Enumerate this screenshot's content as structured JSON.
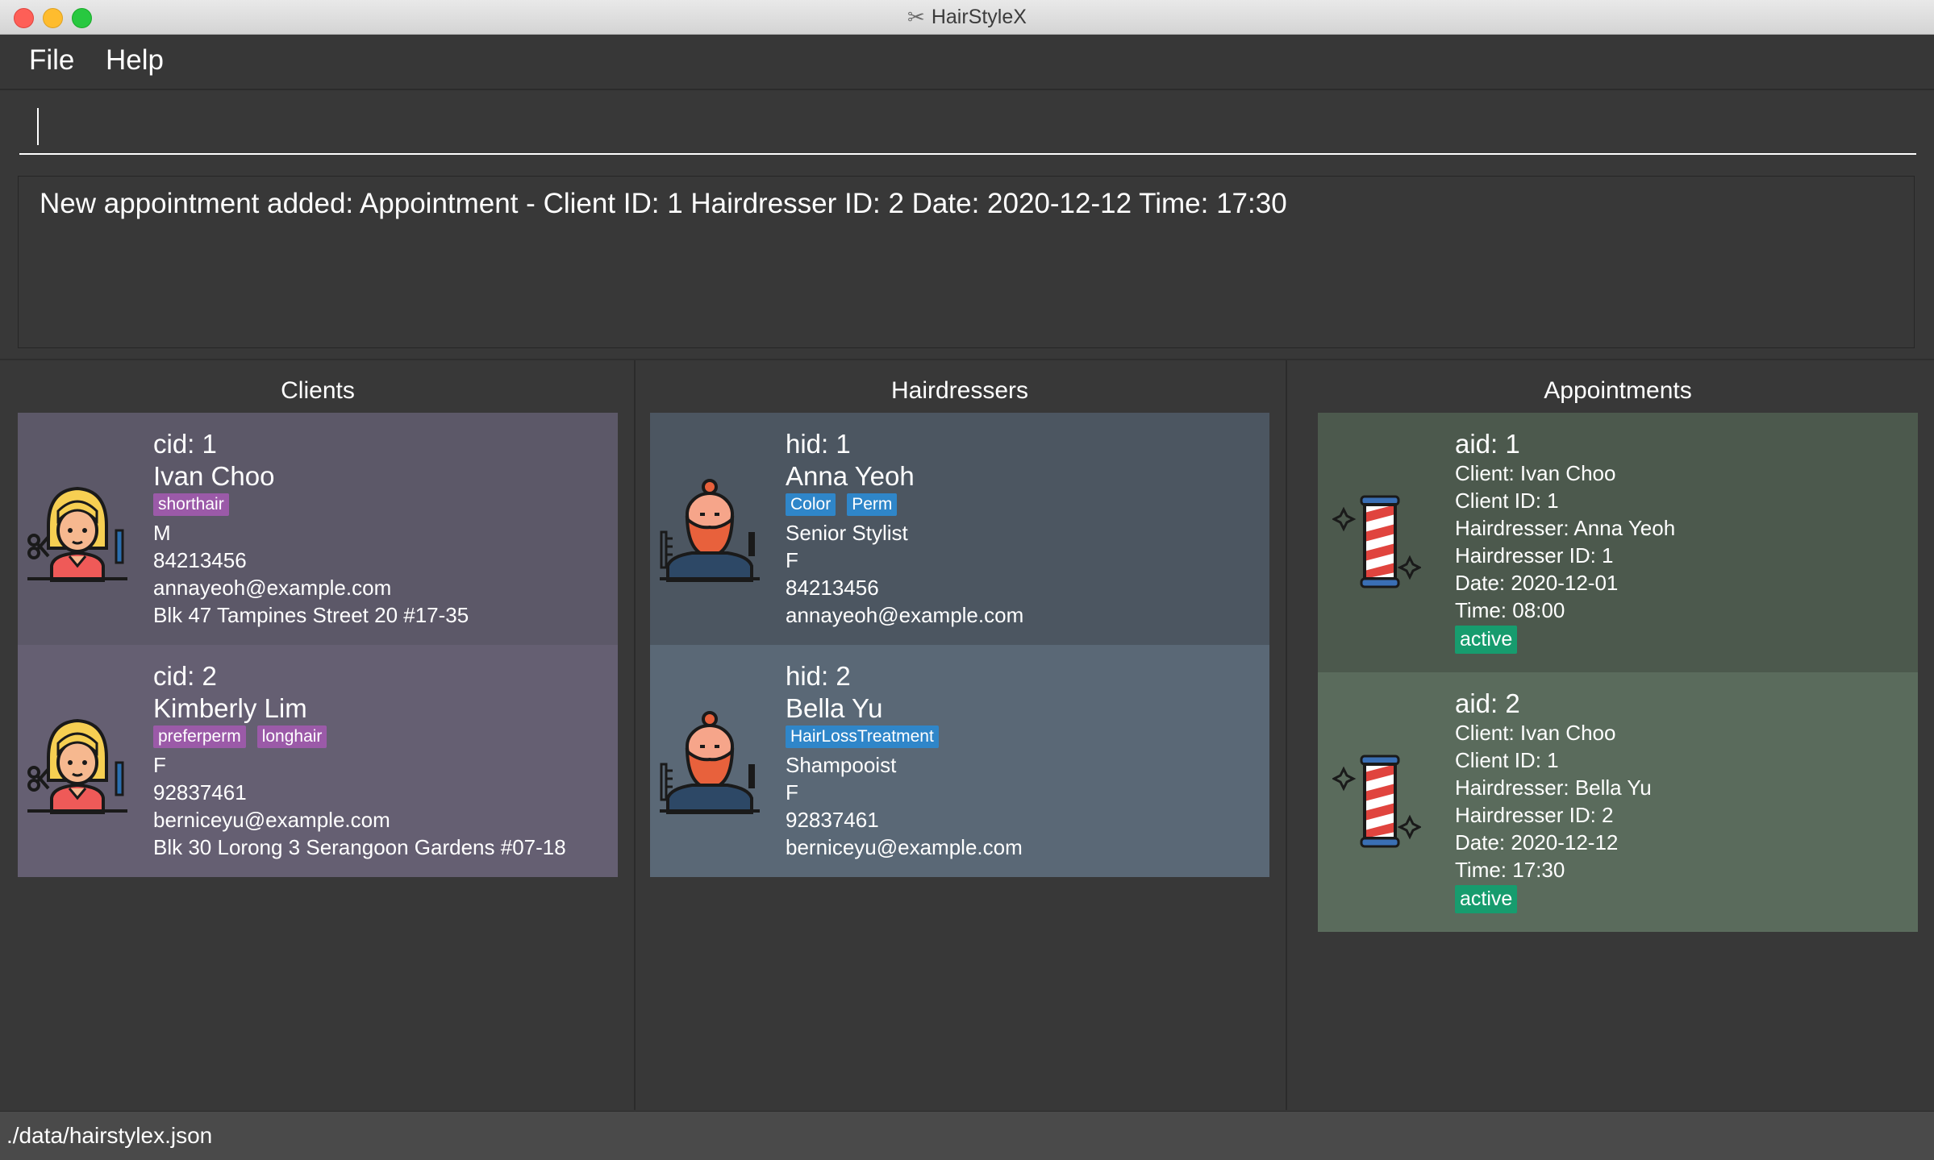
{
  "window": {
    "title": "HairStyleX"
  },
  "menu": {
    "file": "File",
    "help": "Help"
  },
  "command": {
    "value": ""
  },
  "result": {
    "text": "New appointment added: Appointment - Client ID: 1 Hairdresser ID: 2 Date: 2020-12-12 Time: 17:30"
  },
  "columns": {
    "clients": "Clients",
    "hairdressers": "Hairdressers",
    "appointments": "Appointments"
  },
  "clients": [
    {
      "cid": "cid: 1",
      "name": "Ivan Choo",
      "tags": [
        "shorthair"
      ],
      "gender": "M",
      "phone": "84213456",
      "email": "annayeoh@example.com",
      "address": "Blk 47 Tampines Street 20 #17-35"
    },
    {
      "cid": "cid: 2",
      "name": "Kimberly Lim",
      "tags": [
        "preferperm",
        "longhair"
      ],
      "gender": "F",
      "phone": "92837461",
      "email": "berniceyu@example.com",
      "address": "Blk 30 Lorong 3 Serangoon Gardens #07-18"
    }
  ],
  "hairdressers": [
    {
      "hid": "hid: 1",
      "name": "Anna Yeoh",
      "tags": [
        "Color",
        "Perm"
      ],
      "title": "Senior Stylist",
      "gender": "F",
      "phone": "84213456",
      "email": "annayeoh@example.com"
    },
    {
      "hid": "hid: 2",
      "name": "Bella Yu",
      "tags": [
        "HairLossTreatment"
      ],
      "title": "Shampooist",
      "gender": "F",
      "phone": "92837461",
      "email": "berniceyu@example.com"
    }
  ],
  "appointments": [
    {
      "aid": "aid: 1",
      "client": "Client:  Ivan Choo",
      "client_id": "Client ID: 1",
      "hairdresser": "Hairdresser:  Anna Yeoh",
      "hairdresser_id": "Hairdresser ID: 1",
      "date": "Date: 2020-12-01",
      "time": "Time: 08:00",
      "status": "active"
    },
    {
      "aid": "aid: 2",
      "client": "Client:  Ivan Choo",
      "client_id": "Client ID: 1",
      "hairdresser": "Hairdresser:  Bella Yu",
      "hairdresser_id": "Hairdresser ID: 2",
      "date": "Date: 2020-12-12",
      "time": "Time: 17:30",
      "status": "active"
    }
  ],
  "status": {
    "path": "./data/hairstylex.json"
  },
  "icons": {
    "client_avatar": "female-stylist-icon",
    "hairdresser_avatar": "bearded-barber-icon",
    "appointment_avatar": "barber-pole-icon",
    "title": "scissors-icon"
  }
}
